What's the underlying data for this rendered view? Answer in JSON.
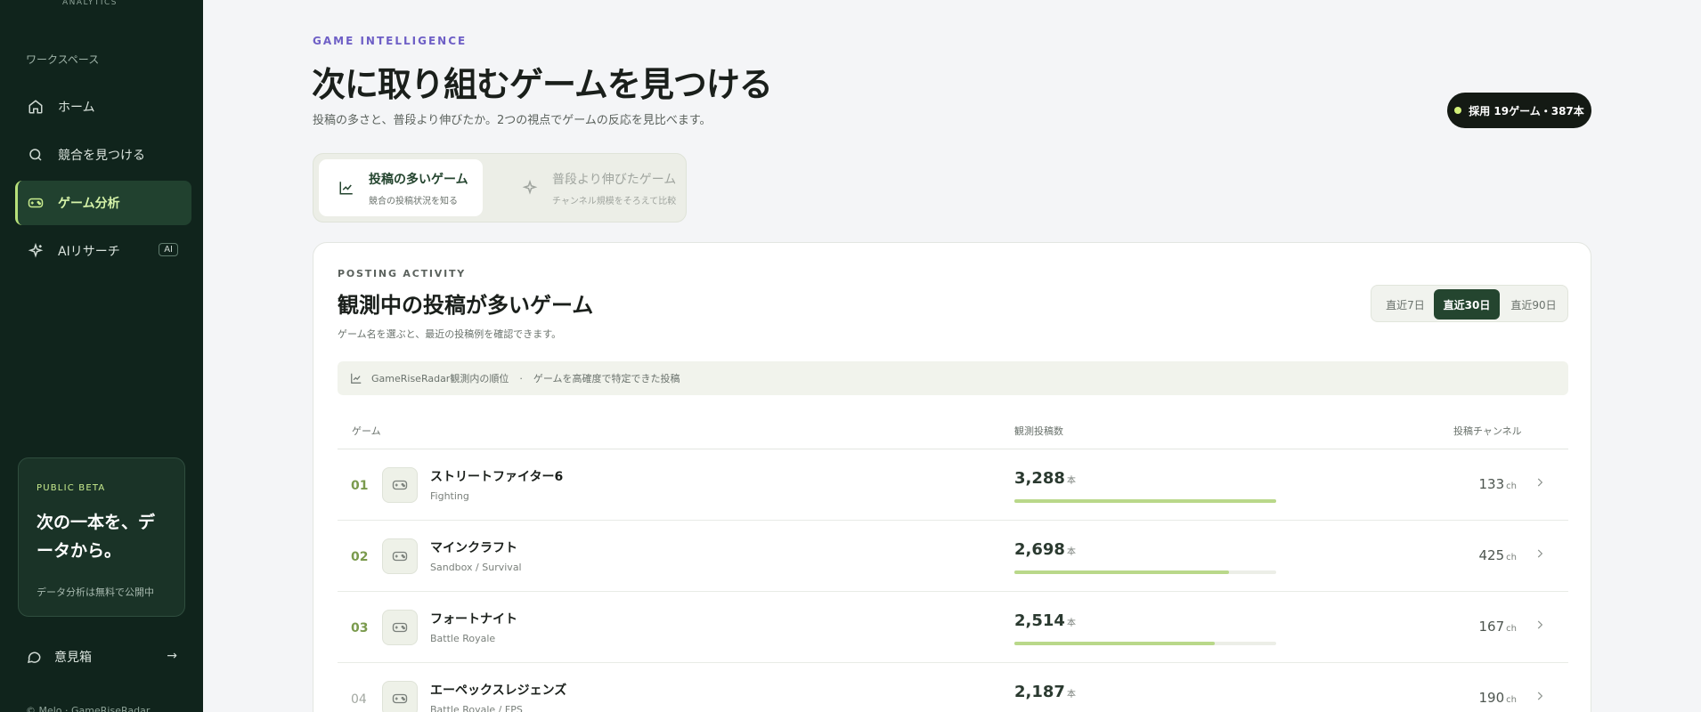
{
  "sidebar": {
    "brand_sub": "ANALYTICS",
    "workspace_label": "ワークスペース",
    "items": [
      {
        "label": "ホーム",
        "icon": "home-icon"
      },
      {
        "label": "競合を見つける",
        "icon": "search-icon"
      },
      {
        "label": "ゲーム分析",
        "icon": "gamepad-icon",
        "active": true
      },
      {
        "label": "AIリサーチ",
        "icon": "sparkle-icon",
        "badge": "AI"
      }
    ],
    "beta": {
      "tag": "PUBLIC BETA",
      "title": "次の一本を、データから。",
      "note": "データ分析は無料で公開中"
    },
    "feedback_label": "意見箱",
    "copyright": "© Melo · GameRiseRadar"
  },
  "header": {
    "eyebrow": "GAME INTELLIGENCE",
    "title": "次に取り組むゲームを見つける",
    "subtitle": "投稿の多さと、普段より伸びたか。2つの視点でゲームの反応を見比べます。",
    "count_pill": "採用 19ゲーム・387本"
  },
  "mode_tabs": [
    {
      "title": "投稿の多いゲーム",
      "sub": "競合の投稿状況を知る",
      "active": true
    },
    {
      "title": "普段より伸びたゲーム",
      "sub": "チャンネル規模をそろえて比較",
      "active": false
    }
  ],
  "card": {
    "eyebrow": "POSTING ACTIVITY",
    "title": "観測中の投稿が多いゲーム",
    "subtitle": "ゲーム名を選ぶと、最近の投稿例を確認できます。",
    "periods": [
      "直近7日",
      "直近30日",
      "直近90日"
    ],
    "active_period": "直近30日",
    "info": {
      "left": "GameRiseRadar観測内の順位",
      "sep": "·",
      "right": "ゲームを高確度で特定できた投稿"
    },
    "columns": {
      "game": "ゲーム",
      "posts": "観測投稿数",
      "channels": "投稿チャンネル"
    },
    "post_unit": "本",
    "channel_unit": "ch",
    "rows": [
      {
        "rank": "01",
        "name": "ストリートファイター6",
        "genre": "Fighting",
        "posts": "3,288",
        "posts_value": 3288,
        "channels": "133"
      },
      {
        "rank": "02",
        "name": "マインクラフト",
        "genre": "Sandbox / Survival",
        "posts": "2,698",
        "posts_value": 2698,
        "channels": "425"
      },
      {
        "rank": "03",
        "name": "フォートナイト",
        "genre": "Battle Royale",
        "posts": "2,514",
        "posts_value": 2514,
        "channels": "167"
      },
      {
        "rank": "04",
        "name": "エーペックスレジェンズ",
        "genre": "Battle Royale / FPS",
        "posts": "2,187",
        "posts_value": 2187,
        "channels": "190"
      }
    ]
  },
  "colors": {
    "sidebar_bg": "#10241c",
    "accent": "#b7e07a",
    "primary": "#24452f",
    "bar": "#b9d88a"
  }
}
